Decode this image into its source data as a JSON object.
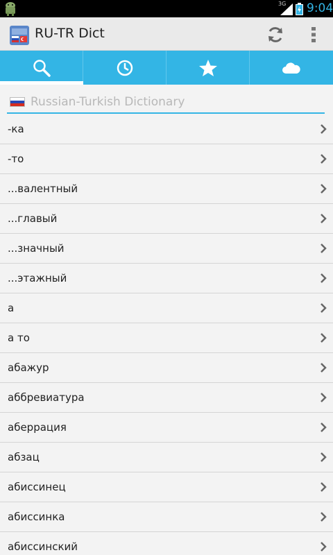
{
  "status_bar": {
    "network": "3G",
    "time": "9:04"
  },
  "app": {
    "title": "RU-TR Dict"
  },
  "tabs": [
    {
      "icon": "search-icon",
      "selected": true
    },
    {
      "icon": "history-clock-icon",
      "selected": false
    },
    {
      "icon": "favorites-star-icon",
      "selected": false
    },
    {
      "icon": "cloud-icon",
      "selected": false
    }
  ],
  "search": {
    "placeholder": "Russian-Turkish Dictionary",
    "value": ""
  },
  "words": [
    "-ка",
    "-то",
    "...валентный",
    "...главый",
    "...значный",
    "...этажный",
    "а",
    "а то",
    "абажур",
    "аббревиатура",
    "аберрация",
    "абзац",
    "абиссинец",
    "абиссинка",
    "абиссинский"
  ],
  "colors": {
    "accent": "#33b5e5",
    "action_bar": "#eaeaea",
    "background": "#f3f3f3"
  }
}
